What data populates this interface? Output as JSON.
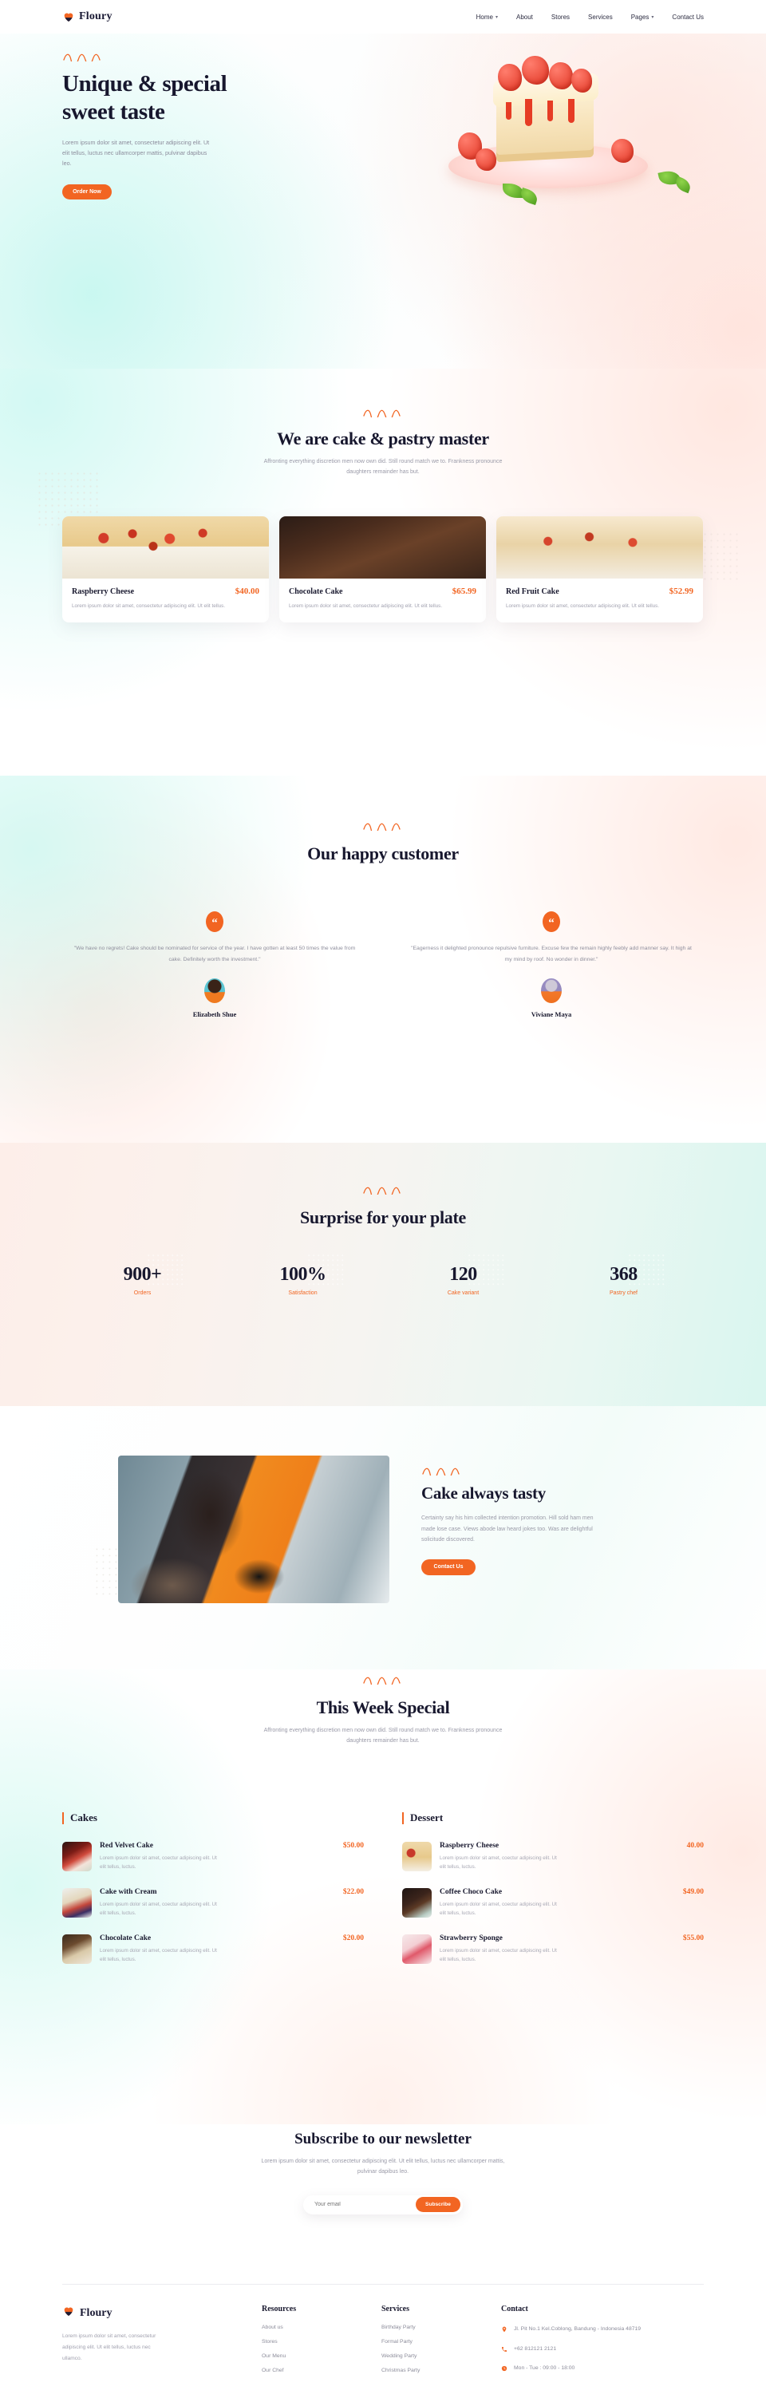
{
  "brand": {
    "name": "Floury",
    "accent": "#f26522",
    "dark": "#17172e"
  },
  "nav": {
    "items": [
      {
        "label": "Home",
        "has_dropdown": true
      },
      {
        "label": "About",
        "has_dropdown": false
      },
      {
        "label": "Stores",
        "has_dropdown": false
      },
      {
        "label": "Services",
        "has_dropdown": false
      },
      {
        "label": "Pages",
        "has_dropdown": true
      },
      {
        "label": "Contact Us",
        "has_dropdown": false
      }
    ]
  },
  "hero": {
    "title_line1": "Unique & special",
    "title_line2": "sweet taste",
    "paragraph": "Lorem ipsum dolor sit amet, consectetur adipiscing elit. Ut elit tellus, luctus nec ullamcorper mattis, pulvinar dapibus leo.",
    "cta": "Order Now"
  },
  "master": {
    "title": "We are cake & pastry master",
    "subtitle": "Affronting everything discretion men now own did. Still round match we to. Frankness pronounce daughters remainder has but.",
    "cards": [
      {
        "title": "Raspberry Cheese",
        "price": "$40.00",
        "desc": "Lorem ipsum dolor sit amet, consectetur adipiscing elit. Ut elit tellus."
      },
      {
        "title": "Chocolate Cake",
        "price": "$65.99",
        "desc": "Lorem ipsum dolor sit amet, consectetur adipiscing elit. Ut elit tellus."
      },
      {
        "title": "Red Fruit Cake",
        "price": "$52.99",
        "desc": "Lorem ipsum dolor sit amet, consectetur adipiscing elit. Ut elit tellus."
      }
    ]
  },
  "customers": {
    "title": "Our happy customer",
    "items": [
      {
        "quote": "\"We have no regrets! Cake should be nominated for service of the year. I have gotten at least 50 times the value from cake. Definitely worth the investment.\"",
        "name": "Elizabeth Shue"
      },
      {
        "quote": "\"Eagerness it delighted pronounce repulsive furniture. Excuse few the remain highly feebly add manner say. It high at my mind by roof. No wonder in dinner.\"",
        "name": "Viviane Maya"
      }
    ]
  },
  "stats": {
    "title": "Surprise for your plate",
    "items": [
      {
        "value": "900+",
        "label": "Orders"
      },
      {
        "value": "100%",
        "label": "Satisfaction"
      },
      {
        "value": "120",
        "label": "Cake variant"
      },
      {
        "value": "368",
        "label": "Pastry chef"
      }
    ]
  },
  "tasty": {
    "title": "Cake always tasty",
    "paragraph": "Certainty say his him collected intention promotion. Hill sold ham men made lose case. Views abode law heard jokes too. Was are delightful solicitude discovered.",
    "cta": "Contact Us"
  },
  "week": {
    "title": "This Week Special",
    "subtitle": "Affronting everything discretion men now own did. Still round match we to. Frankness pronounce daughters remainder has but.",
    "columns": [
      {
        "title": "Cakes",
        "items": [
          {
            "name": "Red Velvet Cake",
            "price": "$50.00",
            "desc": "Lorem ipsum dolor sit amet, coectur adipiscing elit. Ut elit tellus, luctus."
          },
          {
            "name": "Cake with Cream",
            "price": "$22.00",
            "desc": "Lorem ipsum dolor sit amet, coectur adipiscing elit. Ut elit tellus, luctus."
          },
          {
            "name": "Chocolate Cake",
            "price": "$20.00",
            "desc": "Lorem ipsum dolor sit amet, coectur adipiscing elit. Ut elit tellus, luctus."
          }
        ]
      },
      {
        "title": "Dessert",
        "items": [
          {
            "name": "Raspberry Cheese",
            "price": "40.00",
            "desc": "Lorem ipsum dolor sit amet, coectur adipiscing elit. Ut elit tellus, luctus."
          },
          {
            "name": "Coffee Choco Cake",
            "price": "$49.00",
            "desc": "Lorem ipsum dolor sit amet, coectur adipiscing elit. Ut elit tellus, luctus."
          },
          {
            "name": "Strawberry Sponge",
            "price": "$55.00",
            "desc": "Lorem ipsum dolor sit amet, coectur adipiscing elit. Ut elit tellus, luctus."
          }
        ]
      }
    ]
  },
  "newsletter": {
    "title": "Subscribe to our newsletter",
    "subtitle": "Lorem ipsum dolor sit amet, consectetur adipiscing elit. Ut elit tellus, luctus nec ullamcorper mattis, pulvinar dapibus leo.",
    "placeholder": "Your email",
    "button": "Subscribe"
  },
  "footer": {
    "brand": "Floury",
    "desc": "Lorem ipsum dolor sit amet, consectetur adipiscing elit. Ut elit tellus, luctus nec ullamco.",
    "resources": {
      "title": "Resources",
      "links": [
        "About us",
        "Stores",
        "Our Menu",
        "Our Chef"
      ]
    },
    "services": {
      "title": "Services",
      "links": [
        "Birthday Party",
        "Formal Party",
        "Wedding Party",
        "Christmas Party"
      ]
    },
    "contact": {
      "title": "Contact",
      "address": "Jl. Pit No.1 Kel.Coblong, Bandung - Indonesia 48719",
      "phone": "+62 812121 2121",
      "hours": "Mon - Tue : 09:00 - 18:00"
    }
  }
}
